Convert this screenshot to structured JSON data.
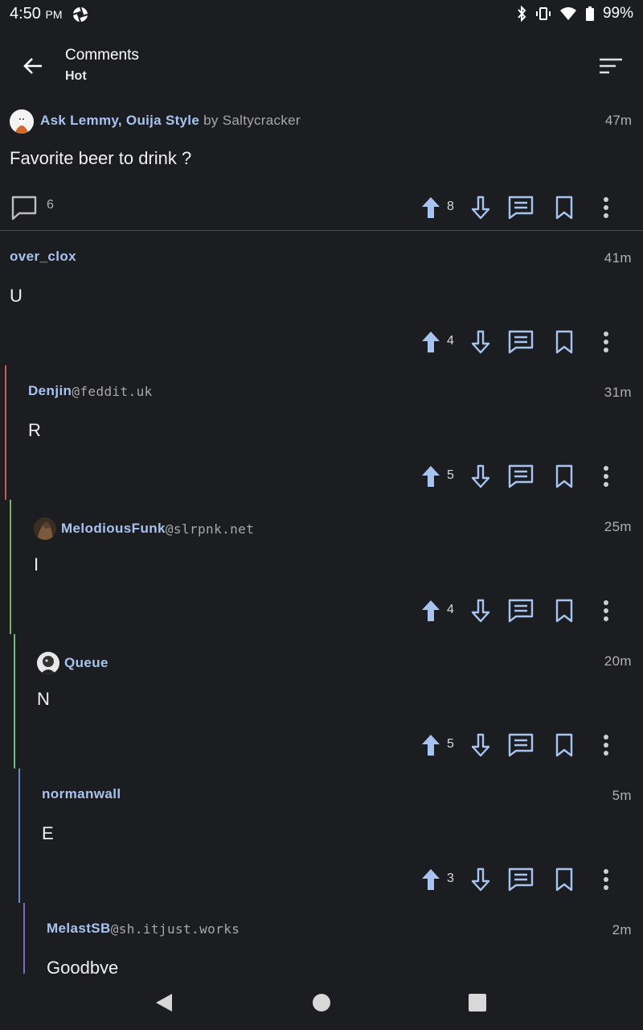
{
  "status_bar": {
    "time": "4:50",
    "ampm": "PM",
    "battery": "99%"
  },
  "header": {
    "title": "Comments",
    "subtitle": "Hot"
  },
  "post": {
    "community": "Ask Lemmy, Ouija Style",
    "by": "by",
    "author": "Saltycracker",
    "time": "47m",
    "title": "Favorite beer to drink ?",
    "comment_count": "6",
    "score": "8"
  },
  "comments": [
    {
      "user": "over_clox",
      "instance": "",
      "time": "41m",
      "body": "U",
      "score": "4",
      "bar_color": ""
    },
    {
      "user": "Denjin",
      "instance": "@feddit.uk",
      "time": "31m",
      "body": "R",
      "score": "5",
      "bar_color": "#c85a5a"
    },
    {
      "user": "MelodiousFunk",
      "instance": "@slrpnk.net",
      "time": "25m",
      "body": "I",
      "score": "4",
      "bar_color": "#7ab06a"
    },
    {
      "user": "Queue",
      "instance": "",
      "time": "20m",
      "body": "N",
      "score": "5",
      "bar_color": "#6ac07a"
    },
    {
      "user": "normanwall",
      "instance": "",
      "time": "5m",
      "body": "E",
      "score": "3",
      "bar_color": "#6a8ac0"
    },
    {
      "user": "MelastSB",
      "instance": "@sh.itjust.works",
      "time": "2m",
      "body": "Goodbye",
      "score": "",
      "bar_color": "#7a6ac0"
    }
  ],
  "icons": {
    "back": "arrow-back-icon",
    "sort": "sort-icon",
    "upvote": "arrow-up-icon",
    "downvote": "arrow-down-icon",
    "reply": "reply-icon",
    "save": "bookmark-icon",
    "more": "more-vert-icon"
  },
  "colors": {
    "background": "#1c1d21",
    "accent": "#a7c4f0"
  }
}
